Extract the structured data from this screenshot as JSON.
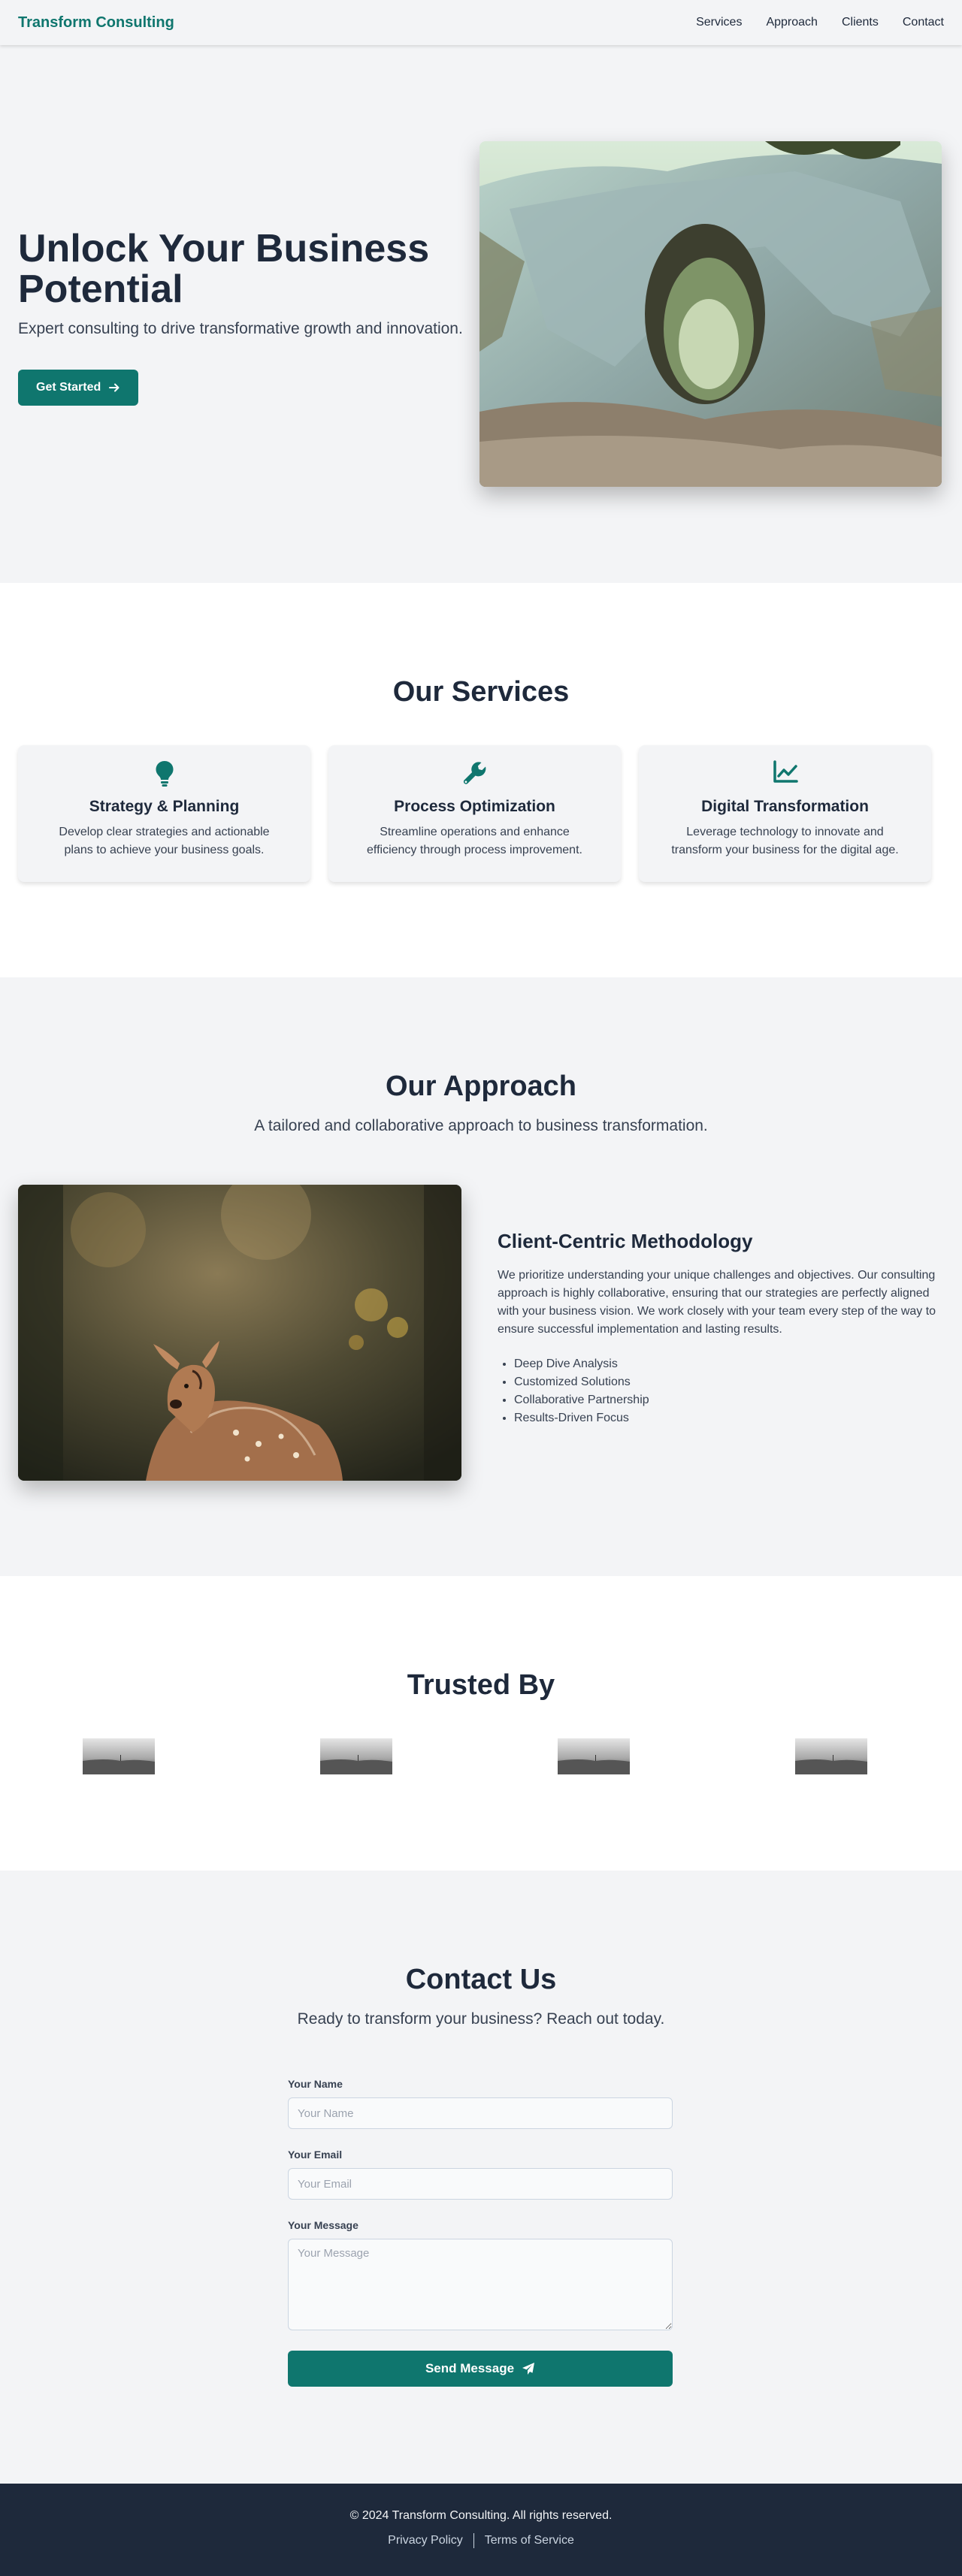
{
  "header": {
    "brand": "Transform Consulting",
    "nav": [
      "Services",
      "Approach",
      "Clients",
      "Contact"
    ]
  },
  "hero": {
    "title": "Unlock Your Business Potential",
    "subtitle": "Expert consulting to drive transformative growth and innovation.",
    "cta_label": "Get Started",
    "cta_icon": "arrow-right-icon"
  },
  "services": {
    "title": "Our Services",
    "cards": [
      {
        "icon": "lightbulb-icon",
        "title": "Strategy & Planning",
        "desc": "Develop clear strategies and actionable plans to achieve your business goals."
      },
      {
        "icon": "wrench-icon",
        "title": "Process Optimization",
        "desc": "Streamline operations and enhance efficiency through process improvement."
      },
      {
        "icon": "chart-line-icon",
        "title": "Digital Transformation",
        "desc": "Leverage technology to innovate and transform your business for the digital age."
      }
    ]
  },
  "approach": {
    "title": "Our Approach",
    "subtitle": "A tailored and collaborative approach to business transformation.",
    "heading": "Client-Centric Methodology",
    "paragraph": "We prioritize understanding your unique challenges and objectives. Our consulting approach is highly collaborative, ensuring that our strategies are perfectly aligned with your business vision. We work closely with your team every step of the way to ensure successful implementation and lasting results.",
    "bullets": [
      "Deep Dive Analysis",
      "Customized Solutions",
      "Collaborative Partnership",
      "Results-Driven Focus"
    ]
  },
  "trusted": {
    "title": "Trusted By"
  },
  "contact": {
    "title": "Contact Us",
    "subtitle": "Ready to transform your business? Reach out today.",
    "name_label": "Your Name",
    "name_placeholder": "Your Name",
    "email_label": "Your Email",
    "email_placeholder": "Your Email",
    "message_label": "Your Message",
    "message_placeholder": "Your Message",
    "send_label": "Send Message",
    "send_icon": "paper-plane-icon"
  },
  "footer": {
    "copyright": "© 2024 Transform Consulting. All rights reserved.",
    "privacy": "Privacy Policy",
    "terms": "Terms of Service"
  },
  "colors": {
    "accent": "#0f766e",
    "dark": "#1e293b",
    "light_bg": "#f3f4f6"
  }
}
